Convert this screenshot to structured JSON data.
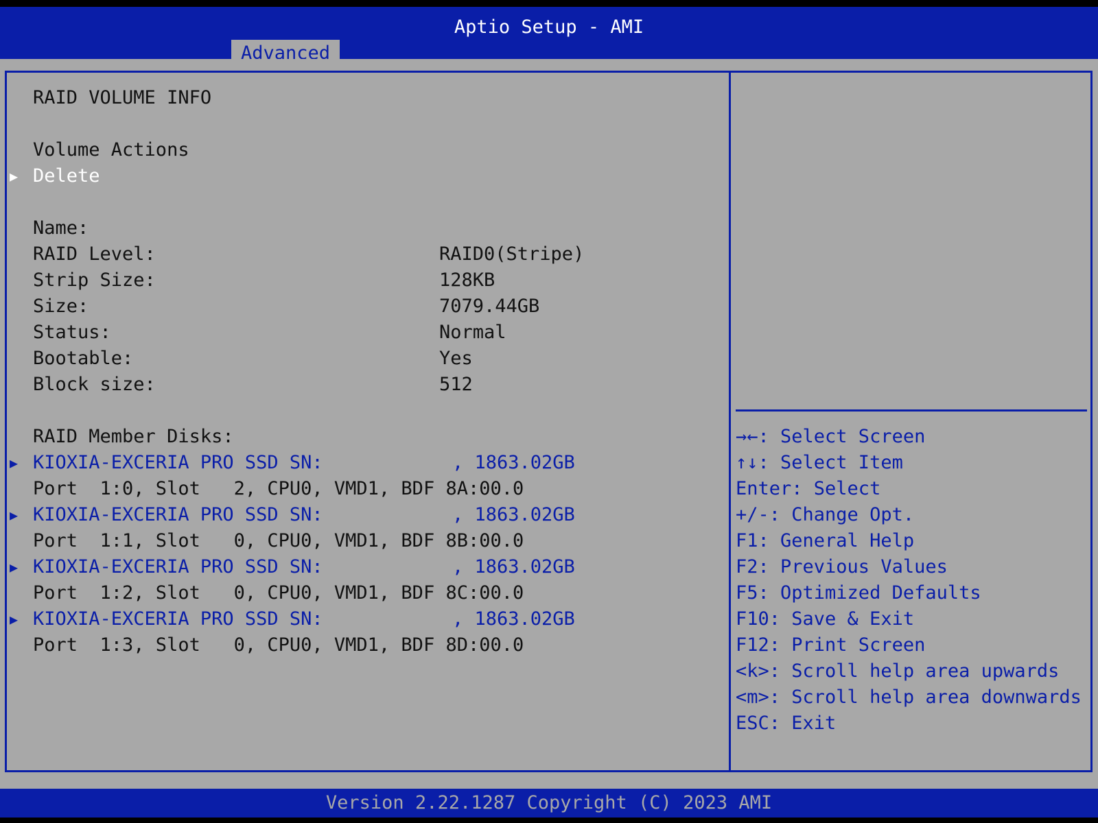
{
  "app": {
    "title": "Aptio Setup - AMI",
    "active_tab": "Advanced",
    "footer": "Version 2.22.1287 Copyright (C) 2023 AMI"
  },
  "colors": {
    "accent": "#0a1ea8",
    "panel": "#a8a8a8",
    "highlight": "#ffffff"
  },
  "main": {
    "heading": "RAID VOLUME INFO",
    "volume_actions_label": "Volume Actions",
    "delete_label": "Delete",
    "fields": [
      {
        "label": "Name:",
        "value": ""
      },
      {
        "label": "RAID Level:",
        "value": "RAID0(Stripe)"
      },
      {
        "label": "Strip Size:",
        "value": "128KB"
      },
      {
        "label": "Size:",
        "value": "7079.44GB"
      },
      {
        "label": "Status:",
        "value": "Normal"
      },
      {
        "label": "Bootable:",
        "value": "Yes"
      },
      {
        "label": "Block size:",
        "value": "512"
      }
    ],
    "members_label": "RAID Member Disks:",
    "disks": [
      {
        "name": "KIOXIA-EXCERIA PRO SSD SN:",
        "size": ", 1863.02GB",
        "location": "Port  1:0, Slot   2, CPU0, VMD1, BDF 8A:00.0"
      },
      {
        "name": "KIOXIA-EXCERIA PRO SSD SN:",
        "size": ", 1863.02GB",
        "location": "Port  1:1, Slot   0, CPU0, VMD1, BDF 8B:00.0"
      },
      {
        "name": "KIOXIA-EXCERIA PRO SSD SN:",
        "size": ", 1863.02GB",
        "location": "Port  1:2, Slot   0, CPU0, VMD1, BDF 8C:00.0"
      },
      {
        "name": "KIOXIA-EXCERIA PRO SSD SN:",
        "size": ", 1863.02GB",
        "location": "Port  1:3, Slot   0, CPU0, VMD1, BDF 8D:00.0"
      }
    ]
  },
  "help": {
    "keys": [
      "→←: Select Screen",
      "↑↓: Select Item",
      "Enter: Select",
      "+/-: Change Opt.",
      "F1: General Help",
      "F2: Previous Values",
      "F5: Optimized Defaults",
      "F10: Save & Exit",
      "F12: Print Screen",
      "<k>: Scroll help area upwards",
      "<m>: Scroll help area downwards",
      "ESC: Exit"
    ]
  }
}
